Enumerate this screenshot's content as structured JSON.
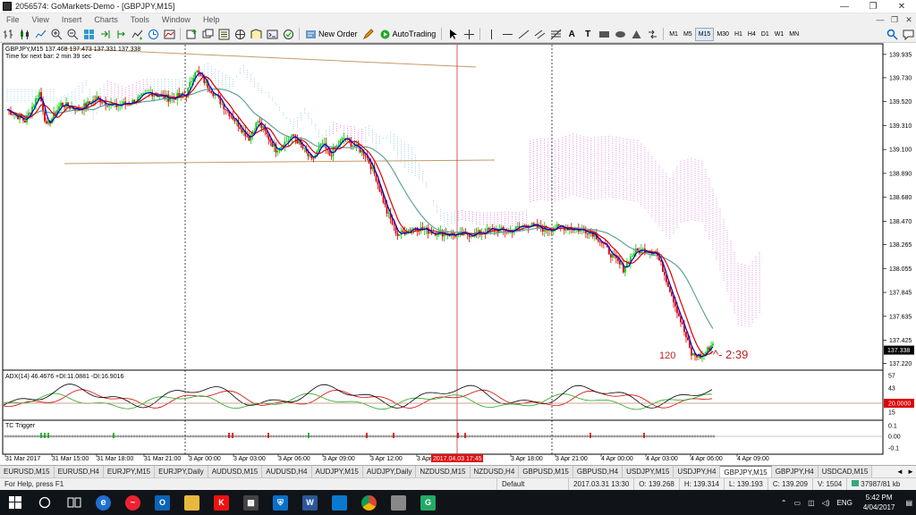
{
  "window": {
    "title": "2056574: GoMarkets-Demo - [GBPJPY,M15]",
    "controls": [
      "—",
      "❐",
      "✕"
    ]
  },
  "menu": {
    "items": [
      "File",
      "View",
      "Insert",
      "Charts",
      "Tools",
      "Window",
      "Help"
    ],
    "mdi": [
      "—",
      "❐",
      "✕"
    ]
  },
  "toolbar": {
    "new_order_label": "New Order",
    "autotrading_label": "AutoTrading",
    "draw_text_label": "A",
    "draw_label_label": "T",
    "timeframes": [
      "M1",
      "M5",
      "M15",
      "M30",
      "H1",
      "H4",
      "D1",
      "W1",
      "MN"
    ],
    "active_timeframe": "M15"
  },
  "chart": {
    "info_line": "GBPJPY,M15  137.468 137.473 137.331 137.338",
    "timer_line": "Time for next bar: 2 min 39 sec",
    "price_labels": [
      "139.935",
      "139.730",
      "139.520",
      "139.310",
      "139.100",
      "138.890",
      "138.680",
      "138.470",
      "138.265",
      "138.055",
      "137.845",
      "137.635",
      "137.425",
      "137.220"
    ],
    "current_price": "137.338",
    "time_labels": [
      "31 Mar 2017",
      "31 Mar 15:00",
      "31 Mar 18:00",
      "31 Mar 21:00",
      "3 Apr 00:00",
      "3 Apr 03:00",
      "3 Apr 06:00",
      "3 Apr 09:00",
      "3 Apr 12:00",
      "3 Apr",
      "3 Apr 18:00",
      "3 Apr 21:00",
      "4 Apr 00:00",
      "4 Apr 03:00",
      "4 Apr 06:00",
      "4 Apr 09:00"
    ],
    "crosshair_time": "2017.04.03 17:45",
    "annotation_count": "120",
    "annotation_timer": "^- 2:39",
    "adx_label": "ADX(14) 46.4676 +DI:11.0881 -DI:16.9016",
    "adx_scale": [
      "57",
      "43",
      "20.0000",
      "15"
    ],
    "tc_label": "TC Trigger",
    "tc_scale": [
      "0.1",
      "0.00",
      "-0.1"
    ],
    "colors": {
      "bull": "#00cc00",
      "bear": "#dd0000",
      "fast_ma": "#0000cc",
      "slow_ma": "#dd0000",
      "long_ma": "#5ea39d",
      "cloud": "#cc44cc",
      "trend": "#c49a6c"
    }
  },
  "tabs": [
    "EURUSD,M15",
    "EURUSD,H4",
    "EURJPY,M15",
    "EURJPY,Daily",
    "AUDUSD,M15",
    "AUDUSD,H4",
    "AUDJPY,M15",
    "AUDJPY,Daily",
    "NZDUSD,M15",
    "NZDUSD,H4",
    "GBPUSD,M15",
    "GBPUSD,H4",
    "USDJPY,M15",
    "USDJPY,H4",
    "GBPJPY,M15",
    "GBPJPY,H4",
    "USDCAD,M15"
  ],
  "active_tab": "GBPJPY,M15",
  "status": {
    "help": "For Help, press F1",
    "profile": "Default",
    "time": "2017.03.31 13:30",
    "open": "O: 139.268",
    "high": "H: 139.314",
    "low": "L: 139.193",
    "close": "C: 139.209",
    "volume": "V: 1504",
    "traffic": "37987/81 kb"
  },
  "taskbar": {
    "lang": "ENG",
    "time": "5:42 PM",
    "date": "4/04/2017"
  }
}
